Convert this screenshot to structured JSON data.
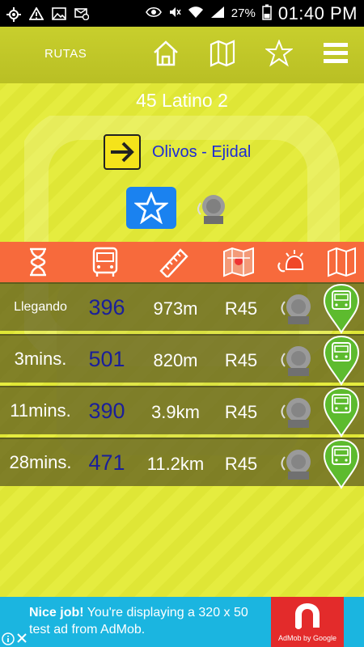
{
  "status_bar": {
    "battery_pct": "27%",
    "time": "01:40 PM"
  },
  "topbar": {
    "title": "RUTAS",
    "icons": [
      "home-icon",
      "map-icon",
      "star-icon",
      "menu-icon"
    ]
  },
  "route": {
    "name": "45 Latino 2",
    "direction": "Olivos - Ejidal"
  },
  "colors": {
    "background": "#e3ea3a",
    "header_orange": "#f76a3c",
    "row_dark": "#5a581e",
    "bus_number": "#1a1f9a",
    "direction_text": "#1c2bd6",
    "favorite_blue": "#1a82f0",
    "pin_green": "#5dbb2e",
    "ad_blue": "#1bb5e0"
  },
  "table": {
    "header_icons": [
      "hourglass-icon",
      "bus-icon",
      "ruler-icon",
      "city-map-icon",
      "alarm-icon",
      "map-icon"
    ],
    "rows": [
      {
        "time": "Llegando",
        "bus": "396",
        "distance": "973m",
        "line": "R45"
      },
      {
        "time": "3mins.",
        "bus": "501",
        "distance": "820m",
        "line": "R45"
      },
      {
        "time": "11mins.",
        "bus": "390",
        "distance": "3.9km",
        "line": "R45"
      },
      {
        "time": "28mins.",
        "bus": "471",
        "distance": "11.2km",
        "line": "R45"
      }
    ]
  },
  "ad": {
    "headline": "Nice job!",
    "body": " You're displaying a 320 x 50 test ad from AdMob.",
    "brand": "AdMob by Google"
  }
}
